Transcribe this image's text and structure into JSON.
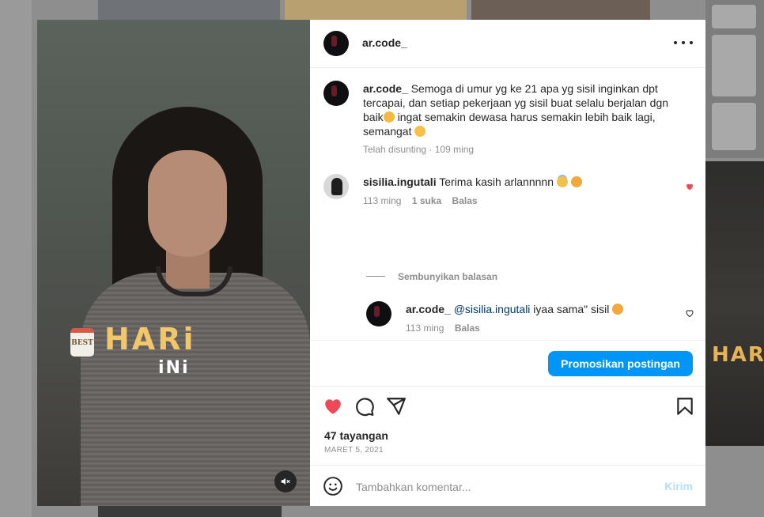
{
  "post": {
    "author": "ar.code_",
    "caption": "Semoga di umur yg ke 21 apa yg sisil inginkan dpt tercapai, dan setiap pekerjaan yg sisil buat selalu berjalan dgn baik",
    "caption_part2": " ingat semakin dewasa harus semakin lebih baik lagi, semangat",
    "edited_label": "Telah disunting",
    "edited_time": "109 ming",
    "views": "47 tayangan",
    "date": "MARET 5, 2021",
    "sticker_best": "BEST",
    "sticker_hari": "HARi",
    "sticker_ini": "iNi"
  },
  "comments": [
    {
      "user": "sisilia.ingutali",
      "text": "Terima kasih arlannnnn",
      "time": "113 ming",
      "likes": "1 suka",
      "reply_label": "Balas",
      "liked": true
    }
  ],
  "hide_replies_label": "Sembunyikan balasan",
  "reply": {
    "user": "ar.code_",
    "mention": "@sisilia.ingutali",
    "text": " iyaa sama\" sisil",
    "time": "113 ming",
    "reply_label": "Balas"
  },
  "promote_button": "Promosikan postingan",
  "comment_box": {
    "placeholder": "Tambahkan komentar...",
    "send_label": "Kirim"
  },
  "colors": {
    "accent": "#0095f6",
    "like": "#ed4956"
  },
  "icons": [
    "more-options-icon",
    "heart-icon",
    "comment-icon",
    "share-icon",
    "bookmark-icon",
    "emoji-icon",
    "mute-icon"
  ]
}
